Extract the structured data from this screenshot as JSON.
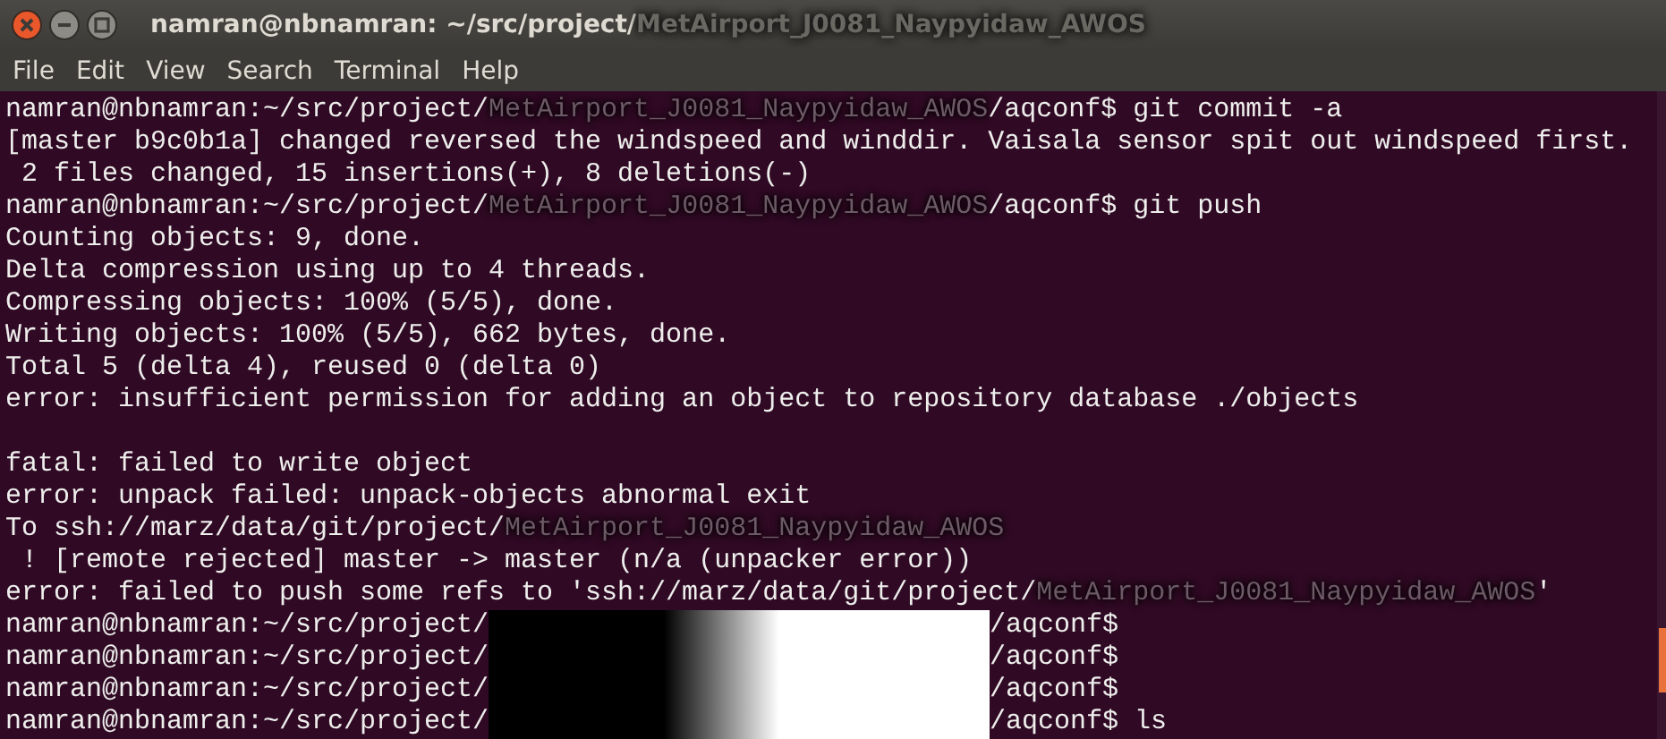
{
  "window": {
    "title": [
      {
        "kind": "text",
        "text": "namran@nbnamran: ~/src/project/"
      },
      {
        "kind": "smudged",
        "text": "MetAirport_J0081_Naypyidaw_AWOS"
      }
    ]
  },
  "menu": [
    "File",
    "Edit",
    "View",
    "Search",
    "Terminal",
    "Help"
  ],
  "lines": [
    [
      {
        "kind": "text",
        "text": "namran@nbnamran:~/src/project/"
      },
      {
        "kind": "smudged",
        "text": "MetAirport_J0081_Naypyidaw_AWOS"
      },
      {
        "kind": "text",
        "text": "/aqconf$ git commit -a"
      }
    ],
    [
      {
        "kind": "text",
        "text": "[master b9c0b1a] changed reversed the windspeed and winddir. Vaisala sensor spit out windspeed first."
      }
    ],
    [
      {
        "kind": "text",
        "text": " 2 files changed, 15 insertions(+), 8 deletions(-)"
      }
    ],
    [
      {
        "kind": "text",
        "text": "namran@nbnamran:~/src/project/"
      },
      {
        "kind": "smudged",
        "text": "MetAirport_J0081_Naypyidaw_AWOS"
      },
      {
        "kind": "text",
        "text": "/aqconf$ git push"
      }
    ],
    [
      {
        "kind": "text",
        "text": "Counting objects: 9, done."
      }
    ],
    [
      {
        "kind": "text",
        "text": "Delta compression using up to 4 threads."
      }
    ],
    [
      {
        "kind": "text",
        "text": "Compressing objects: 100% (5/5), done."
      }
    ],
    [
      {
        "kind": "text",
        "text": "Writing objects: 100% (5/5), 662 bytes, done."
      }
    ],
    [
      {
        "kind": "text",
        "text": "Total 5 (delta 4), reused 0 (delta 0)"
      }
    ],
    [
      {
        "kind": "text",
        "text": "error: insufficient permission for adding an object to repository database ./objects"
      }
    ],
    [
      {
        "kind": "blank"
      }
    ],
    [
      {
        "kind": "text",
        "text": "fatal: failed to write object"
      }
    ],
    [
      {
        "kind": "text",
        "text": "error: unpack failed: unpack-objects abnormal exit"
      }
    ],
    [
      {
        "kind": "text",
        "text": "To ssh://marz/data/git/project/"
      },
      {
        "kind": "smudged",
        "text": "MetAirport_J0081_Naypyidaw_AWOS"
      }
    ],
    [
      {
        "kind": "text",
        "text": " ! [remote rejected] master -> master (n/a (unpacker error))"
      }
    ],
    [
      {
        "kind": "text",
        "text": "error: failed to push some refs to 'ssh://marz/data/git/project/"
      },
      {
        "kind": "smudged",
        "text": "MetAirport_J0081_Naypyidaw_AWOS"
      },
      {
        "kind": "text",
        "text": "'"
      }
    ],
    [
      {
        "kind": "text",
        "text": "namran@nbnamran:~/src/project/"
      },
      {
        "kind": "blackout"
      },
      {
        "kind": "text",
        "text": "/aqconf$"
      }
    ],
    [
      {
        "kind": "text",
        "text": "namran@nbnamran:~/src/project/"
      },
      {
        "kind": "blackout"
      },
      {
        "kind": "text",
        "text": "/aqconf$"
      }
    ],
    [
      {
        "kind": "text",
        "text": "namran@nbnamran:~/src/project/"
      },
      {
        "kind": "blackout"
      },
      {
        "kind": "text",
        "text": "/aqconf$"
      }
    ],
    [
      {
        "kind": "text",
        "text": "namran@nbnamran:~/src/project/"
      },
      {
        "kind": "blackout"
      },
      {
        "kind": "text",
        "text": "/aqconf$ ls"
      }
    ]
  ]
}
